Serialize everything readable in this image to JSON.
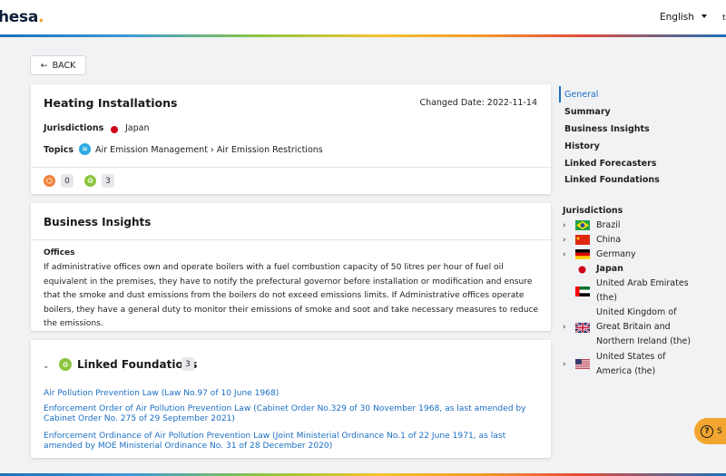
{
  "header": {
    "logo_text": "hesa",
    "logo_dot": ".",
    "language": "English",
    "edge_text": "t"
  },
  "back_label": "BACK",
  "requirement": {
    "title": "Heating Installations",
    "changed_date": "Changed Date: 2022-11-14",
    "jurisdictions_label": "Jurisdictions",
    "jurisdiction": "Japan",
    "topics_label": "Topics",
    "topic": "Air Emission Management › Air Emission Restrictions",
    "counts": [
      {
        "icon": "forecaster-icon",
        "value": "0",
        "color": "#f0823a"
      },
      {
        "icon": "foundation-icon",
        "value": "3",
        "color": "#8cc63f"
      }
    ]
  },
  "business_insights": {
    "title": "Business Insights",
    "subheading": "Offices",
    "text": "If administrative offices own and operate boilers with a fuel combustion capacity of 50 litres per hour of fuel oil equivalent in the premises, they have to notify the prefectural governor before installation or modification and ensure that the smoke and dust emissions from the boilers do not exceed emissions limits. If Administrative offices operate boilers, they have a general duty to monitor their emissions of smoke and soot and take necessary measures to reduce the emissions."
  },
  "linked_foundations": {
    "title": "Linked Foundations",
    "count": "3",
    "items": [
      "Air Pollution Prevention Law (Law No.97 of 10 June 1968)",
      "Enforcement Order of Air Pollution Prevention Law (Cabinet Order No.329 of 30 November 1968, as last amended by Cabinet Order No. 275 of 29 September 2021)",
      "Enforcement Ordinance of Air Pollution Prevention Law (Joint Ministerial Ordinance No.1 of 22 June 1971, as last amended by MOE Ministerial Ordinance No. 31 of 28 December 2020)"
    ]
  },
  "sidebar": {
    "nav": [
      "General",
      "Summary",
      "Business Insights",
      "History",
      "Linked Forecasters",
      "Linked Foundations"
    ],
    "jurisdictions_title": "Jurisdictions",
    "jurisdictions": [
      {
        "name": "Brazil",
        "flag": "brazil-flag-icon",
        "expandable": true
      },
      {
        "name": "China",
        "flag": "china-flag-icon",
        "expandable": true
      },
      {
        "name": "Germany",
        "flag": "germany-flag-icon",
        "expandable": true
      },
      {
        "name": "Japan",
        "flag": "japan-flag-icon",
        "expandable": false,
        "current": true
      },
      {
        "name_lines": [
          "United Arab Emirates",
          "(the)"
        ],
        "flag": "uae-flag-icon",
        "expandable": false
      },
      {
        "name_lines": [
          "United Kingdom of",
          "Great Britain and",
          "Northern Ireland (the)"
        ],
        "flag": "uk-flag-icon",
        "expandable": true
      },
      {
        "name_lines": [
          "United States of",
          "America (the)"
        ],
        "flag": "usa-flag-icon",
        "expandable": true
      }
    ]
  },
  "help_label": "S"
}
